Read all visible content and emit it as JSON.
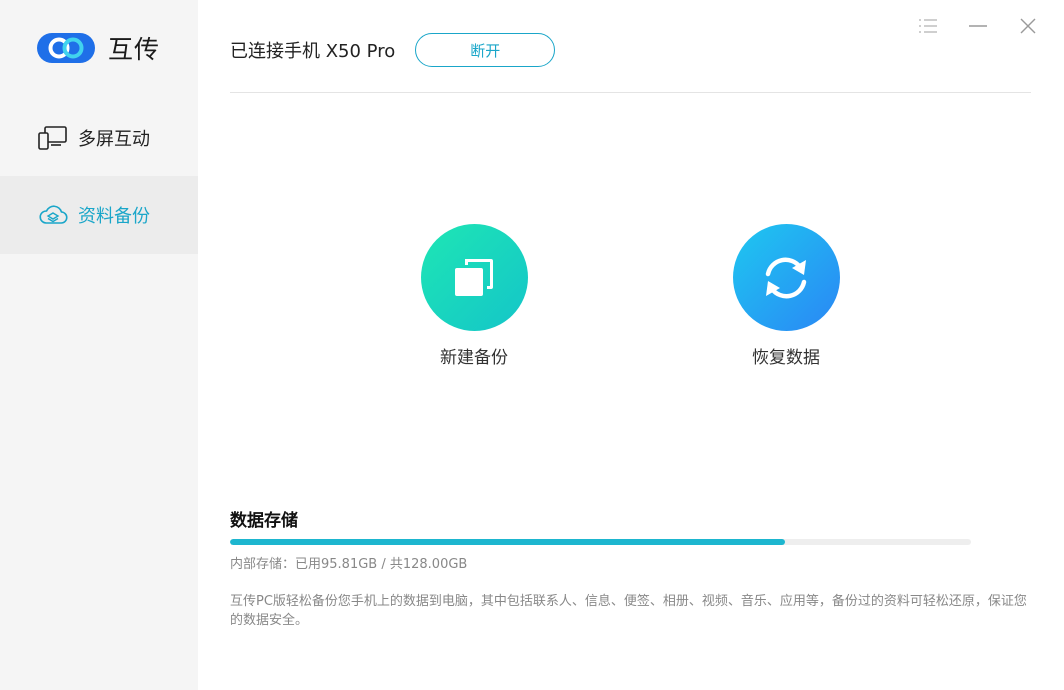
{
  "app": {
    "name": "互传",
    "brand_color": "#1aa6c9"
  },
  "sidebar": {
    "items": [
      {
        "label": "多屏互动",
        "icon": "multi-screen-icon",
        "active": false
      },
      {
        "label": "资料备份",
        "icon": "cloud-backup-icon",
        "active": true
      }
    ]
  },
  "window_controls": {
    "menu_icon": "menu-list-icon",
    "minimize_icon": "minimize-icon",
    "close_icon": "close-icon"
  },
  "header": {
    "device_status": "已连接手机 X50 Pro",
    "disconnect_label": "断开"
  },
  "actions": {
    "new_backup": {
      "label": "新建备份",
      "icon": "copy-icon"
    },
    "restore": {
      "label": "恢复数据",
      "icon": "refresh-icon"
    }
  },
  "storage": {
    "title": "数据存储",
    "info": "内部存储：已用95.81GB / 共128.00GB",
    "used_fraction": 0.7485,
    "description": "互传PC版轻松备份您手机上的数据到电脑，其中包括联系人、信息、便签、相册、视频、音乐、应用等，备份过的资料可轻松还原，保证您的数据安全。"
  }
}
